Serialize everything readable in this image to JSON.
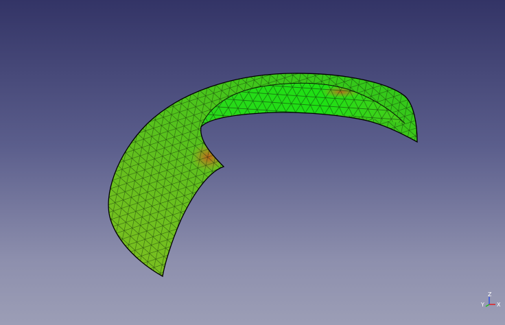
{
  "viewport": {
    "background_top": "#333466",
    "background_bottom": "#9c9eb6"
  },
  "model": {
    "surface_color": "#3fd21a",
    "hot_spot_color": "#c4621c",
    "mesh_line_color": "#0d2a08",
    "edge_color": "#000000"
  },
  "axis_triad": {
    "x_label": "X",
    "y_label": "Y",
    "z_label": "Z",
    "x_color": "#e02020",
    "y_color": "#20c020",
    "z_color": "#3050e0"
  }
}
